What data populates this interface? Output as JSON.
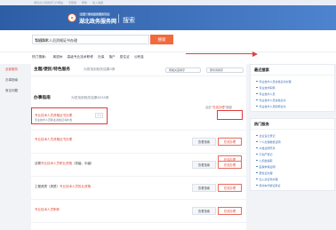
{
  "topbar": {
    "links": [
      "湖北省人民政府门户网站",
      "无障碍",
      "繁体",
      "加入收藏"
    ]
  },
  "header": {
    "logo_subtitle": "全国一体化政务服务平台",
    "logo_title": "湖北政务服务网",
    "page_title": "搜索"
  },
  "search": {
    "value": "专业技术人员资格证书办理",
    "count": "12/150",
    "button_label": "搜索"
  },
  "hotbar": {
    "label": "热门搜索：",
    "items": [
      "离退休",
      "高级专业技术职称",
      "社保",
      "落户",
      "居住证",
      "公积金"
    ]
  },
  "leftnav": {
    "items": [
      "全部服务",
      "办事指南",
      "常见问题"
    ]
  },
  "main": {
    "tab_label": "主题/便民/特色服务",
    "top_count": "为您找到相关结果0条",
    "sort_options": [
      "按相关度排序",
      "按时间排序"
    ],
    "guide_title": "办事指南",
    "guide_count": "为您找到相关结果6255条",
    "online_tip_prefix": "点击",
    "online_tip_link": "“在线办理”",
    "online_tip_suffix": "按钮",
    "rows": [
      {
        "title": "专业技术人员资格证书办理",
        "subtitle": "专业技术人员职业资格证书补发",
        "tag": "个人",
        "guide": "",
        "online": "在线办理"
      },
      {
        "title": "专业技术人员资格证书办理",
        "subtitle": "",
        "tag": "",
        "guide": "查看指南",
        "online": "在线办理"
      },
      {
        "title_prefix": "法规",
        "title_red": "专业技术人员职业资格",
        "title_suffix": "（初级、中级）",
        "guide": "查看指南",
        "online": "在线办理"
      },
      {
        "title_prefix": "工程资质（资质）",
        "title_red": "专业技术人员执业资格",
        "title_suffix": "",
        "guide": "查看指南",
        "online": "在线办理"
      },
      {
        "title": "专业技术人员职称",
        "subtitle": "",
        "tag": "",
        "guide": "查看指南",
        "online": "在线办理"
      }
    ]
  },
  "right": {
    "recent_title": "最近搜索",
    "recent": [
      "专业技术人员资格证书办理",
      "专业技术职称",
      "专业技术人员",
      "专业技术人员资格证书",
      "专业技术人员职称证书"
    ],
    "hot_title": "热门服务",
    "hot": [
      "企业设立登记",
      "个人社保缴费证明",
      "户籍证明开具",
      "不动产登记",
      "公积金提取",
      "医保参保证明",
      "居住证办理",
      "出入境证件办理",
      "机动车驾驶证换证"
    ]
  }
}
